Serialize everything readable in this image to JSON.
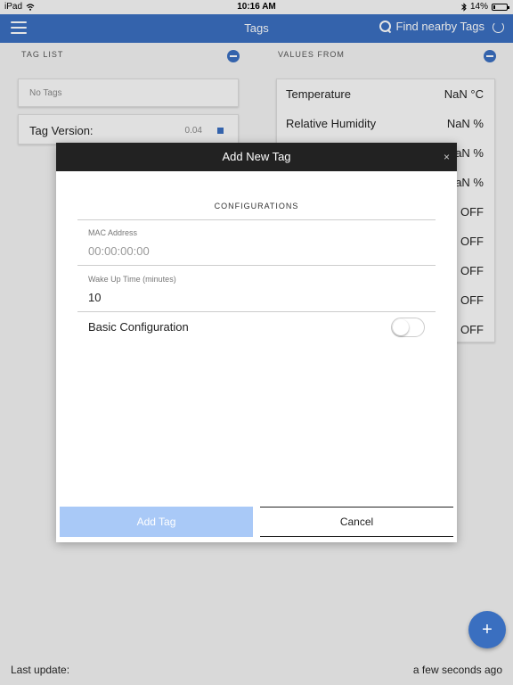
{
  "status_bar": {
    "device": "iPad",
    "time": "10:16 AM",
    "battery": "14%",
    "battery_level": 0.14,
    "wifi_icon": "wifi-icon",
    "bluetooth_icon": "bluetooth-icon"
  },
  "nav": {
    "title": "Tags",
    "find_label": "Find nearby Tags",
    "menu_icon": "hamburger-icon",
    "search_icon": "search-icon",
    "refresh_icon": "refresh-icon",
    "color": "#3a6fc0"
  },
  "tag_list": {
    "header": "TAG LIST",
    "no_tags": "No Tags",
    "version_label": "Tag Version:",
    "version_value": "0.04"
  },
  "values": {
    "header": "VALUES FROM",
    "rows": [
      {
        "name": "Temperature",
        "value": "NaN °C"
      },
      {
        "name": "Relative Humidity",
        "value": "NaN %"
      },
      {
        "name": "",
        "value": "aN %"
      },
      {
        "name": "",
        "value": "aN %"
      },
      {
        "name": "",
        "value": "OFF"
      },
      {
        "name": "",
        "value": "OFF"
      },
      {
        "name": "",
        "value": "OFF"
      },
      {
        "name": "",
        "value": "OFF"
      },
      {
        "name": "",
        "value": "OFF"
      }
    ]
  },
  "modal": {
    "title": "Add New Tag",
    "close": "×",
    "section": "CONFIGURATIONS",
    "mac_label": "MAC Address",
    "mac_placeholder": "00:00:00:00",
    "wake_label": "Wake Up Time (minutes)",
    "wake_value": "10",
    "basic_config_label": "Basic Configuration",
    "basic_config_on": false,
    "add_button": "Add Tag",
    "cancel_button": "Cancel"
  },
  "fab": {
    "label": "+"
  },
  "footer": {
    "last_update_label": "Last update:",
    "last_update_value": "a few seconds ago"
  }
}
